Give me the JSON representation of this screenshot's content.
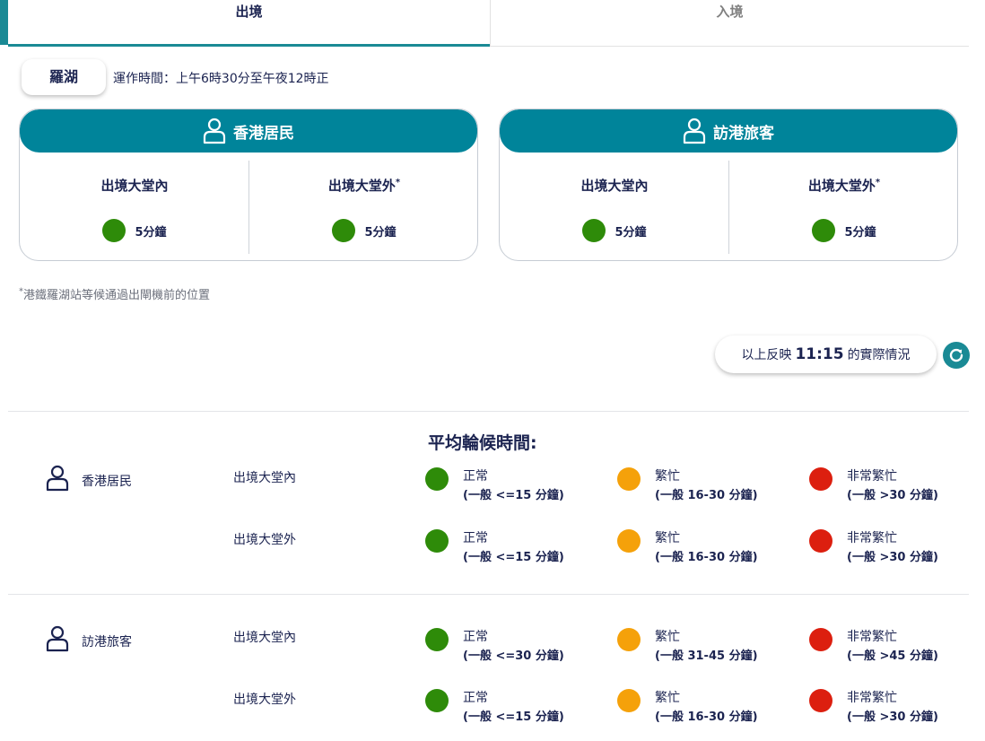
{
  "tabs": {
    "departure": "出境",
    "arrival": "入境"
  },
  "station": {
    "name": "羅湖",
    "hours": "運作時間：上午6時30分至午夜12時正"
  },
  "cards": [
    {
      "title": "香港居民",
      "cols": [
        {
          "label": "出境大堂內",
          "mark": "",
          "status": "5分鐘",
          "color": "#2e8b09"
        },
        {
          "label": "出境大堂外",
          "mark": "*",
          "status": "5分鐘",
          "color": "#2e8b09"
        }
      ]
    },
    {
      "title": "訪港旅客",
      "cols": [
        {
          "label": "出境大堂內",
          "mark": "",
          "status": "5分鐘",
          "color": "#2e8b09"
        },
        {
          "label": "出境大堂外",
          "mark": "*",
          "status": "5分鐘",
          "color": "#2e8b09"
        }
      ]
    }
  ],
  "footnote": {
    "mark": "*",
    "text": "港鐵羅湖站等候通過出閘機前的位置"
  },
  "update": {
    "prefix": "以上反映",
    "time": "11:15",
    "suffix": "的實際情況"
  },
  "legend": {
    "title": "平均輪候時間:",
    "groups": [
      {
        "name": "香港居民",
        "rows": [
          {
            "label": "出境大堂內",
            "items": [
              {
                "name": "正常",
                "range": "(一般 <=15 分鐘)"
              },
              {
                "name": "繁忙",
                "range": "(一般 16-30 分鐘)"
              },
              {
                "name": "非常繁忙",
                "range": "(一般 >30 分鐘)"
              }
            ]
          },
          {
            "label": "出境大堂外",
            "items": [
              {
                "name": "正常",
                "range": "(一般 <=15 分鐘)"
              },
              {
                "name": "繁忙",
                "range": "(一般 16-30 分鐘)"
              },
              {
                "name": "非常繁忙",
                "range": "(一般 >30 分鐘)"
              }
            ]
          }
        ]
      },
      {
        "name": "訪港旅客",
        "rows": [
          {
            "label": "出境大堂內",
            "items": [
              {
                "name": "正常",
                "range": "(一般 <=30 分鐘)"
              },
              {
                "name": "繁忙",
                "range": "(一般 31-45 分鐘)"
              },
              {
                "name": "非常繁忙",
                "range": "(一般 >45 分鐘)"
              }
            ]
          },
          {
            "label": "出境大堂外",
            "items": [
              {
                "name": "正常",
                "range": "(一般 <=15 分鐘)"
              },
              {
                "name": "繁忙",
                "range": "(一般 16-30 分鐘)"
              },
              {
                "name": "非常繁忙",
                "range": "(一般 >30 分鐘)"
              }
            ]
          }
        ]
      }
    ]
  },
  "colors": {
    "accent": "#00849a",
    "normal": "#2e8b09",
    "busy": "#f5a10a",
    "very_busy": "#dc1f0f"
  }
}
